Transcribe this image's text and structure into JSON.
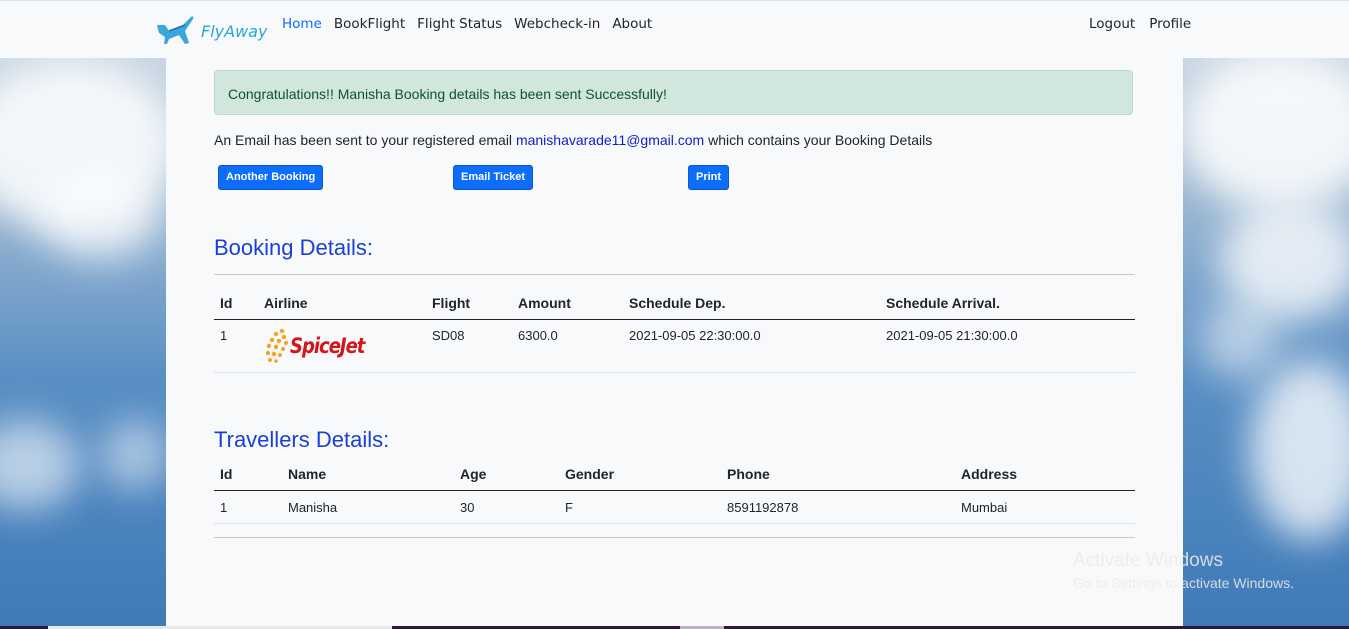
{
  "navbar": {
    "brand": "FlyAway",
    "links": [
      "Home",
      "BookFlight",
      "Flight Status",
      "Webcheck-in",
      "About"
    ],
    "right_links": [
      "Logout",
      "Profile"
    ]
  },
  "alert": "Congratulations!! Manisha Booking details has been sent Successfully!",
  "email_line": {
    "prefix": "An Email has been sent to your registered email",
    "email": "manishavarade11@gmail.com",
    "suffix": "which contains your Booking Details"
  },
  "buttons": {
    "another_booking": "Another Booking",
    "email_ticket": "Email Ticket",
    "print": "Print"
  },
  "booking": {
    "heading": "Booking Details:",
    "columns": [
      "Id",
      "Airline",
      "Flight",
      "Amount",
      "Schedule Dep.",
      "Schedule Arrival."
    ],
    "row": {
      "id": "1",
      "airline_logo_text": "SpiceJet",
      "flight": "SD08",
      "amount": "6300.0",
      "dep": "2021-09-05 22:30:00.0",
      "arr": "2021-09-05 21:30:00.0"
    }
  },
  "travellers": {
    "heading": "Travellers Details:",
    "columns": [
      "Id",
      "Name",
      "Age",
      "Gender",
      "Phone",
      "Address"
    ],
    "row": {
      "id": "1",
      "name": "Manisha",
      "age": "30",
      "gender": "F",
      "phone": "8591192878",
      "address": "Mumbai"
    }
  },
  "watermark": {
    "title": "Activate Windows",
    "subtitle": "Go to Settings to activate Windows."
  },
  "colors": {
    "accent": "#0d6efd",
    "heading": "#1c3fd6",
    "alert_bg": "#d1e7dd",
    "alert_text": "#0f5132",
    "brand": "#2aa7d8",
    "spicejet": "#d3161b"
  }
}
